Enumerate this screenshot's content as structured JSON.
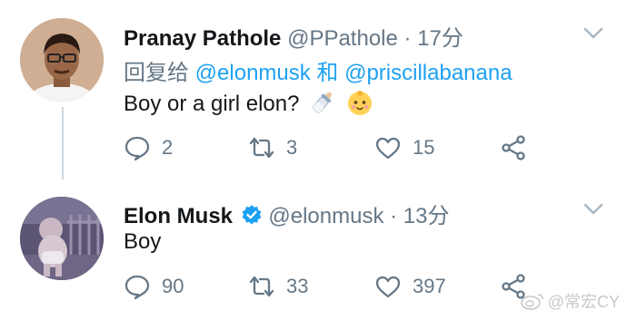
{
  "tweets": [
    {
      "name": "Pranay Pathole",
      "handle": "@PPathole",
      "separator": "·",
      "time": "17分",
      "reply_prefix": "回复给",
      "reply_mention_1": "@elonmusk",
      "reply_joiner": "和",
      "reply_mention_2": "@priscillabanana",
      "text": "Boy or a girl elon?",
      "emojis": [
        "baby-bottle-icon",
        "baby-face-icon"
      ],
      "replies": "2",
      "retweets": "3",
      "likes": "15"
    },
    {
      "name": "Elon Musk",
      "handle": "@elonmusk",
      "separator": "·",
      "time": "13分",
      "verified": true,
      "text": "Boy",
      "replies": "90",
      "retweets": "33",
      "likes": "397"
    }
  ],
  "watermark": "@常宏CY",
  "colors": {
    "link": "#1da1f2",
    "secondary": "#657786",
    "thread_line": "#ccd6dd"
  }
}
